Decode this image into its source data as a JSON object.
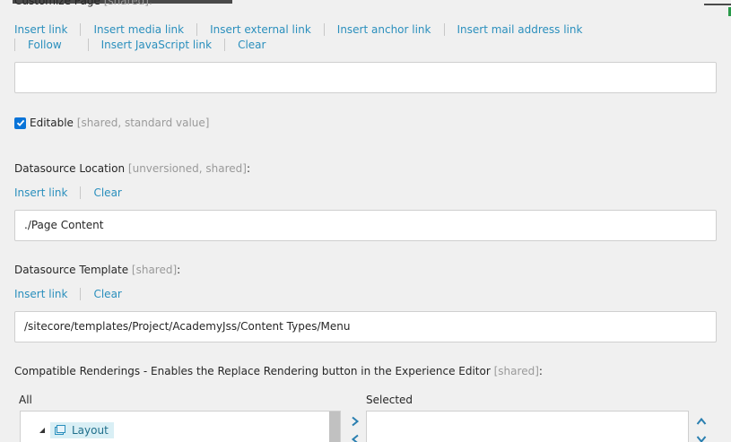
{
  "customize": {
    "label": "Customize Page",
    "meta": "[shared]:",
    "links": [
      "Insert link",
      "Insert media link",
      "Insert external link",
      "Insert anchor link",
      "Insert mail address link",
      "Follow",
      "Insert JavaScript link",
      "Clear"
    ],
    "value": ""
  },
  "editable": {
    "label": "Editable",
    "meta": "[shared, standard value]",
    "checked": true
  },
  "datasource_location": {
    "label": "Datasource Location",
    "meta": "[unversioned, shared]",
    "suffix": ":",
    "links": [
      "Insert link",
      "Clear"
    ],
    "value": "./Page Content"
  },
  "datasource_template": {
    "label": "Datasource Template",
    "meta": "[shared]",
    "suffix": ":",
    "links": [
      "Insert link",
      "Clear"
    ],
    "value": "/sitecore/templates/Project/AcademyJss/Content Types/Menu"
  },
  "compatible": {
    "label": "Compatible Renderings - Enables the Replace Rendering button in the Experience Editor",
    "meta": "[shared]",
    "suffix": ":",
    "all_label": "All",
    "selected_label": "Selected",
    "tree_item": "Layout"
  },
  "colors": {
    "link": "#2a8fbd",
    "meta": "#9a9a9a",
    "checkbox": "#0a74d8"
  }
}
